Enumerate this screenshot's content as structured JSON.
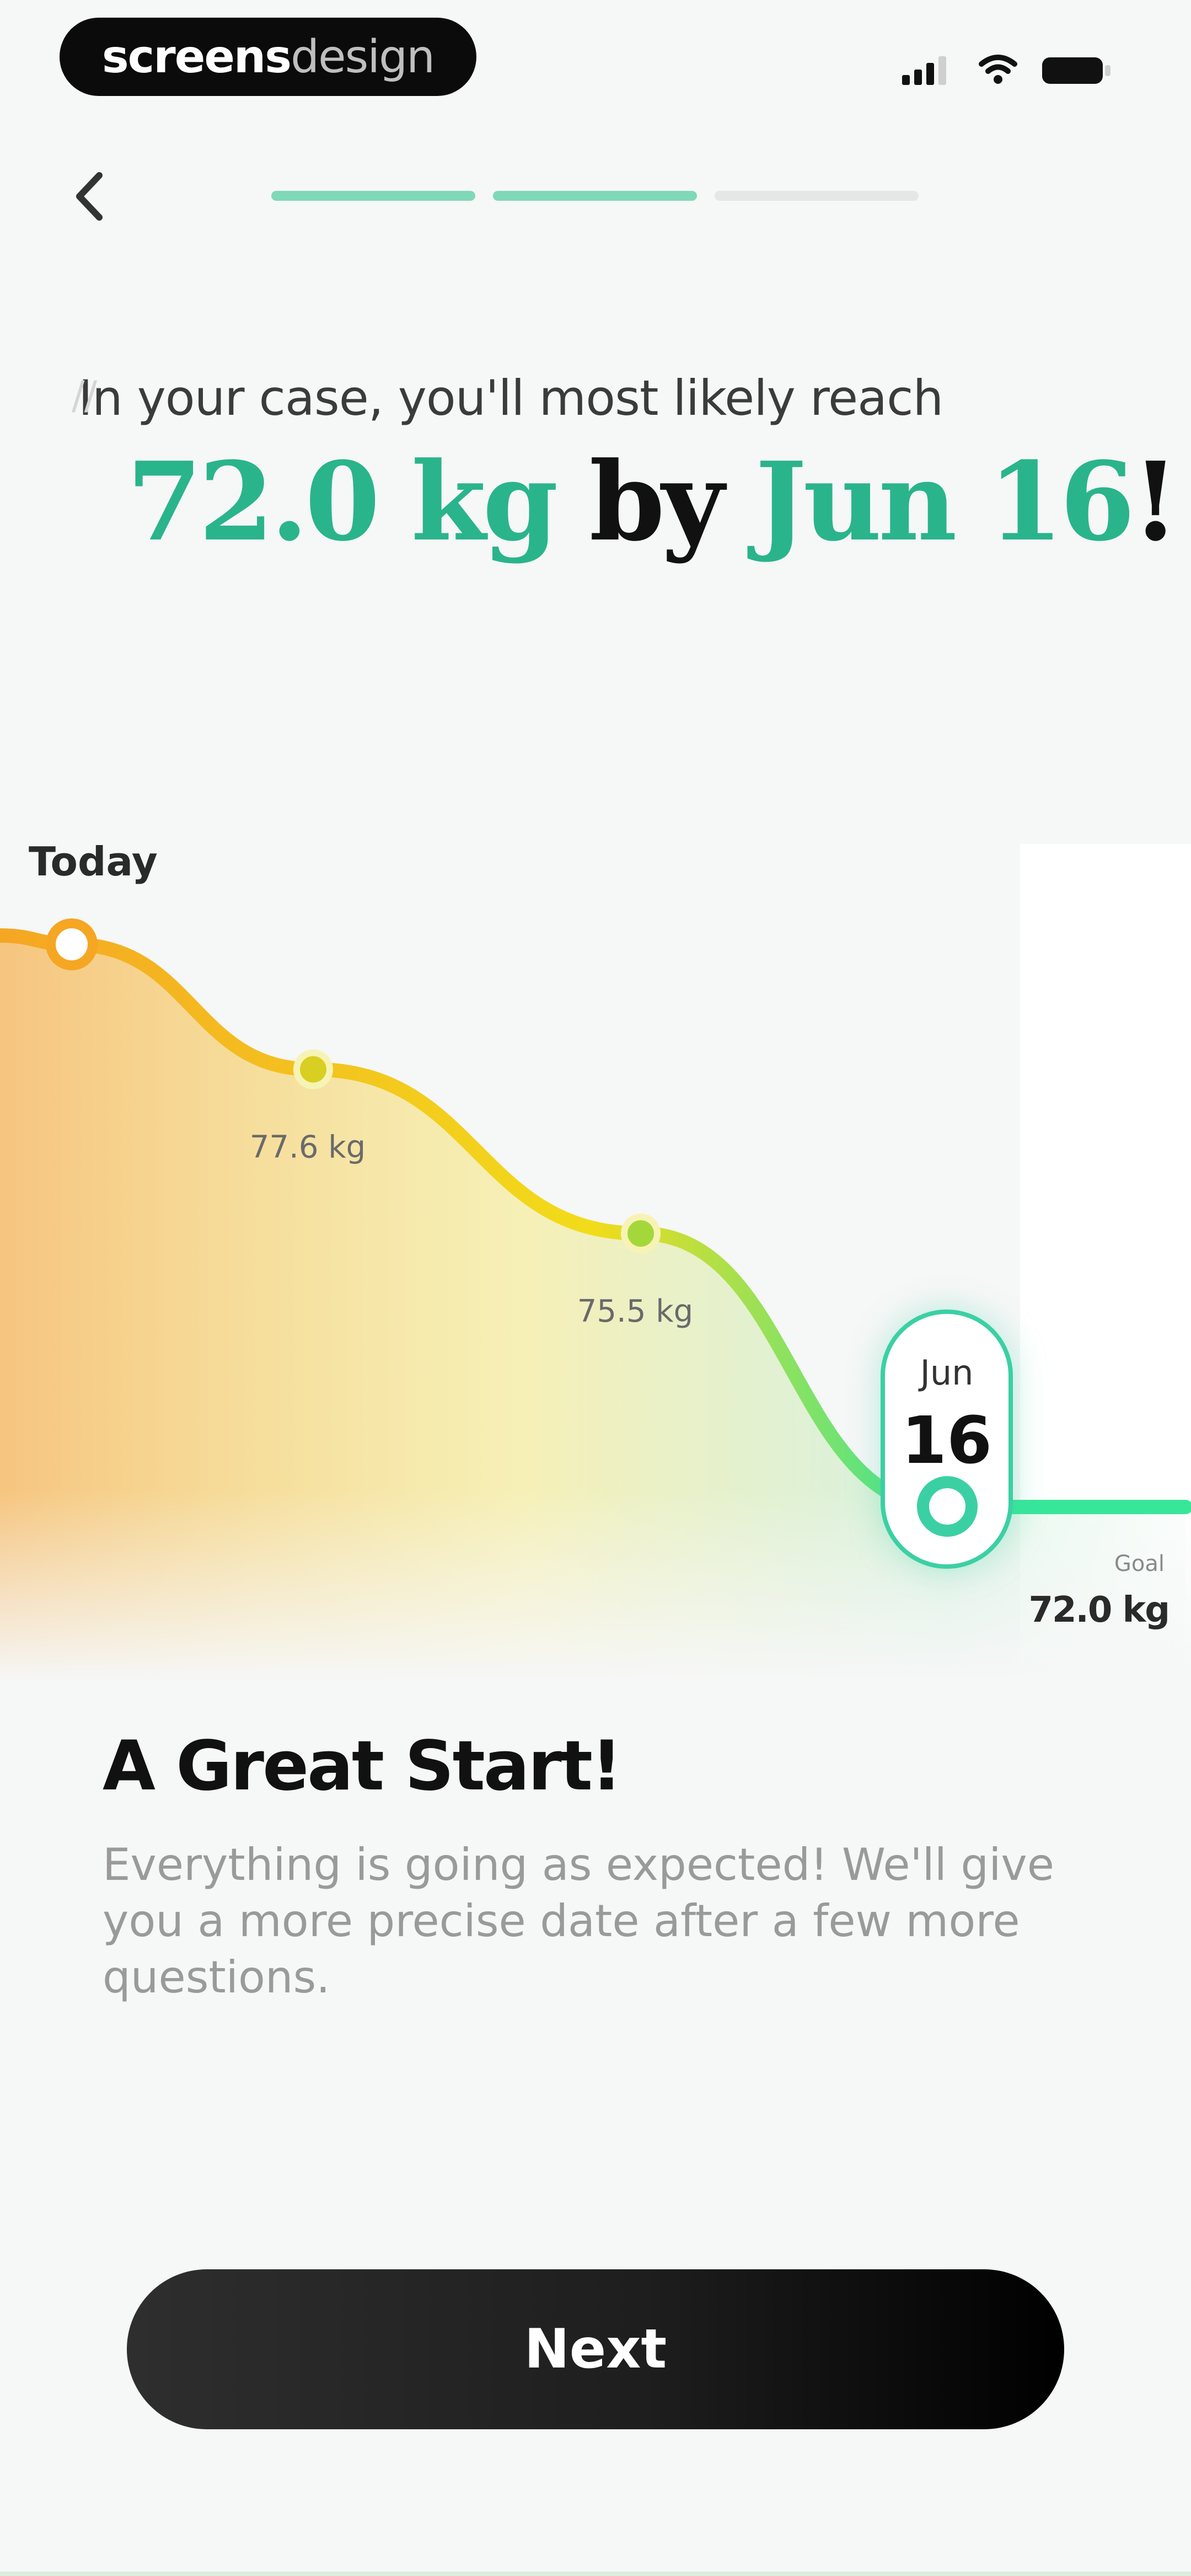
{
  "status_bar": {
    "brand_part1": "screens",
    "brand_part2": "design",
    "icons": [
      "signal-icon",
      "wifi-icon",
      "battery-icon"
    ]
  },
  "nav": {
    "back_icon": "chevron-left-icon",
    "progress": {
      "total_steps": 3,
      "completed_steps": 2,
      "active_color": "#7fd9b8",
      "inactive_color": "#e4e7e6"
    }
  },
  "header": {
    "subtitle": "In your case, you'll most likely reach",
    "goal_weight": "72.0 kg",
    "connector": "by",
    "goal_date": "Jun 16",
    "exclamation": "!"
  },
  "chart_data": {
    "type": "area",
    "x": [
      "Today",
      "",
      "",
      "Jun 16",
      ""
    ],
    "values": [
      79.2,
      77.6,
      75.5,
      72.0,
      72.0
    ],
    "point_labels": [
      "",
      "77.6 kg",
      "75.5 kg",
      "",
      ""
    ],
    "start_label": "Today",
    "highlight": {
      "month": "Jun",
      "day": "16"
    },
    "goal_label": "Goal",
    "goal_value": "72.0 kg",
    "colors": {
      "start": "#f5a623",
      "mid": "#f2dc1a",
      "end": "#38e69a",
      "accent": "#3bd0a4"
    },
    "grid": false
  },
  "card": {
    "title": "A Great Start!",
    "body": "Everything is going as expected! We'll give you a more precise date after a few more questions."
  },
  "cta": {
    "label": "Next"
  }
}
